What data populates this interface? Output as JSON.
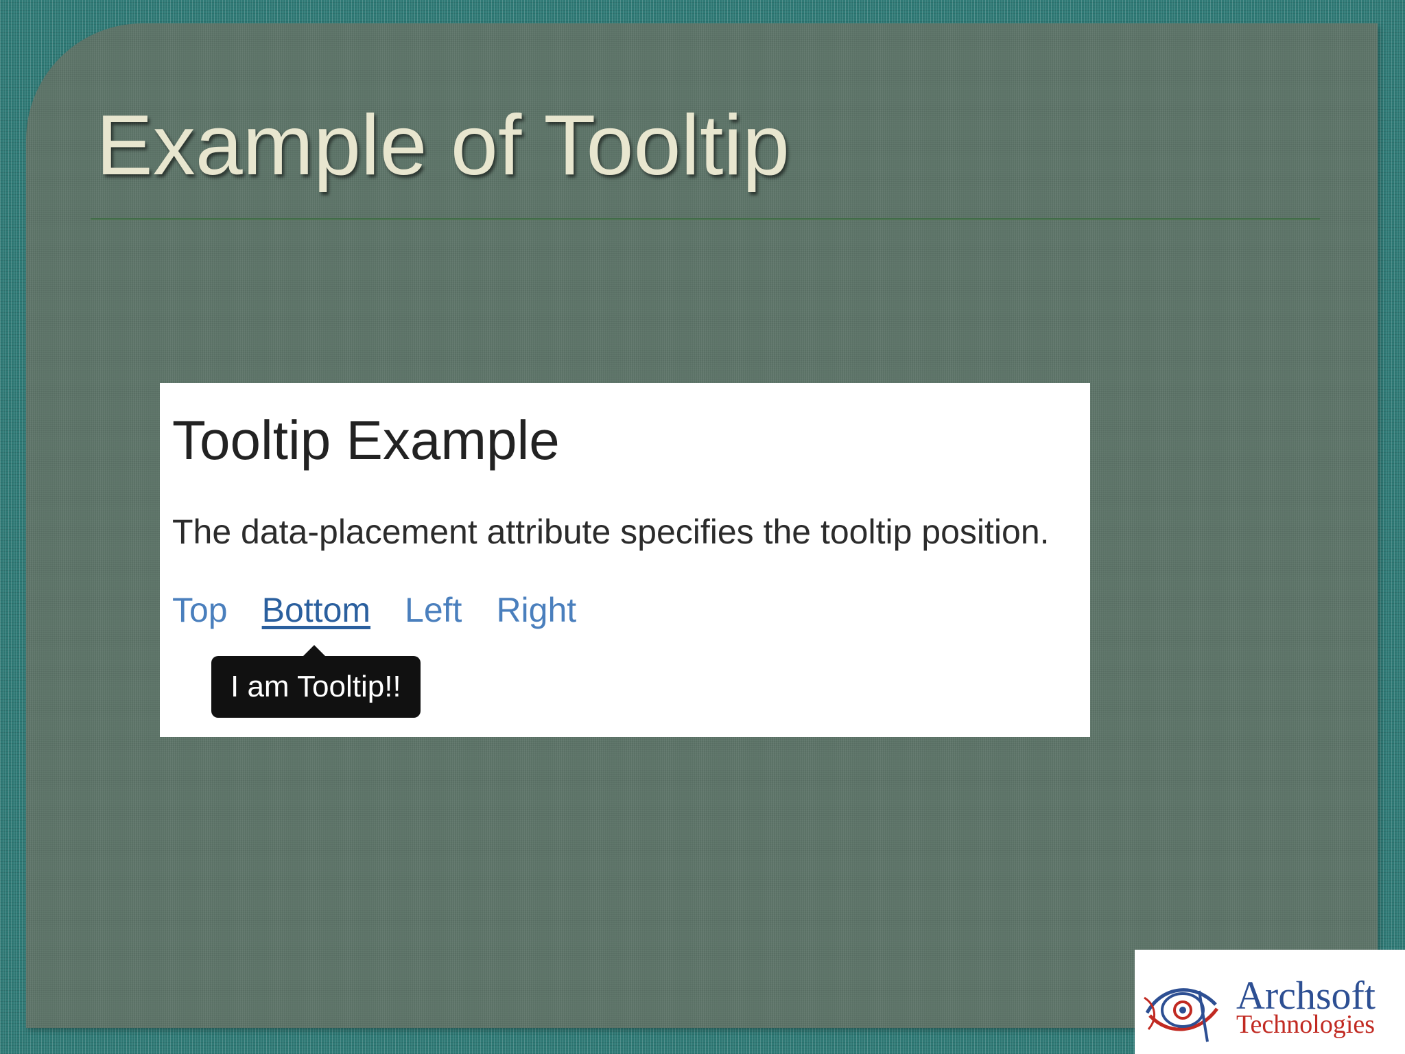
{
  "slide": {
    "title": "Example of Tooltip"
  },
  "demo": {
    "heading": "Tooltip Example",
    "paragraph": "The data-placement attribute specifies the tooltip position.",
    "links": [
      {
        "label": "Top"
      },
      {
        "label": "Bottom",
        "state": "hovered"
      },
      {
        "label": "Left"
      },
      {
        "label": "Right"
      }
    ],
    "tooltip": {
      "text": "I am Tooltip!!",
      "placement": "bottom"
    }
  },
  "logo": {
    "line1": "Archsoft",
    "line2": "Technologies"
  },
  "colors": {
    "outer_background": "#2f7a76",
    "panel_background": "#5d7468",
    "title_text": "#e8e6cf",
    "link": "#4a7fbd",
    "link_active": "#2a5f9e",
    "tooltip_background": "#111111",
    "logo_blue": "#2d4f93",
    "logo_red": "#c12a22"
  },
  "icons": {
    "logo_mark": "eye-swirl-logo-icon"
  }
}
